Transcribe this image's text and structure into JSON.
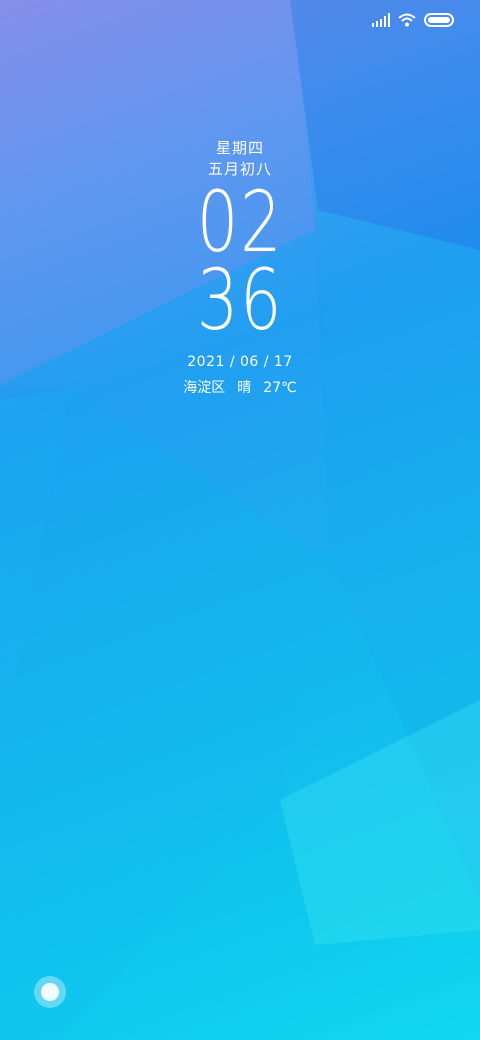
{
  "status_bar": {
    "signal_icon": "cellular-signal-icon",
    "wifi_icon": "wifi-icon",
    "battery_icon": "battery-icon"
  },
  "lock_screen": {
    "weekday": "星期四",
    "lunar_date": "五月初八",
    "hour": "02",
    "minute": "36",
    "date": "2021 / 06 / 17",
    "location": "海淀区",
    "weather": "晴",
    "temperature": "27℃"
  },
  "assistant": {
    "icon": "assistant-circle-icon"
  },
  "colors": {
    "top_left": "#8a8fe6",
    "mid_blue": "#1f9bf0",
    "bottom_cyan": "#10d8f0",
    "text": "#ffffff"
  }
}
